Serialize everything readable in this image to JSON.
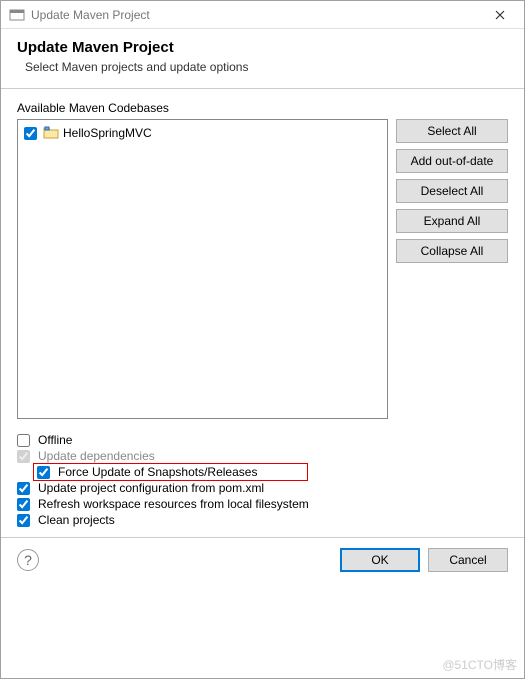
{
  "titlebar": {
    "text": "Update Maven Project"
  },
  "header": {
    "title": "Update Maven Project",
    "desc": "Select Maven projects and update options"
  },
  "section_label": "Available Maven Codebases",
  "tree": {
    "items": [
      {
        "label": "HelloSpringMVC",
        "checked": true
      }
    ]
  },
  "side_buttons": {
    "select_all": "Select All",
    "add_out_of_date": "Add out-of-date",
    "deselect_all": "Deselect All",
    "expand_all": "Expand All",
    "collapse_all": "Collapse All"
  },
  "options": {
    "offline": {
      "label": "Offline",
      "checked": false
    },
    "update_deps": {
      "label": "Update dependencies",
      "checked": true,
      "disabled": true
    },
    "force_update": {
      "label": "Force Update of Snapshots/Releases",
      "checked": true
    },
    "update_config": {
      "label": "Update project configuration from pom.xml",
      "checked": true
    },
    "refresh_ws": {
      "label": "Refresh workspace resources from local filesystem",
      "checked": true
    },
    "clean": {
      "label": "Clean projects",
      "checked": true
    }
  },
  "footer": {
    "ok": "OK",
    "cancel": "Cancel"
  },
  "watermark": "@51CTO博客"
}
